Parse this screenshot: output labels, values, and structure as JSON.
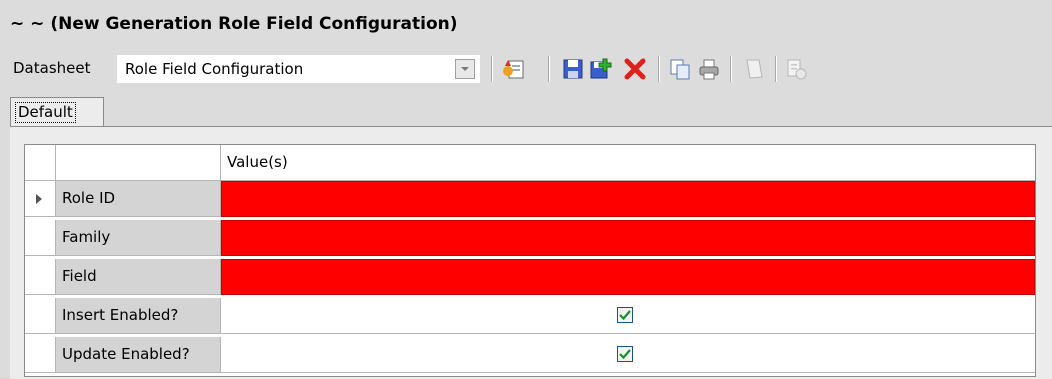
{
  "header": {
    "title": "~ ~ (New Generation Role Field Configuration)"
  },
  "toolbar": {
    "datasheet_label": "Datasheet",
    "datasheet_value": "Role Field Configuration",
    "icons": [
      "new-record-icon",
      "save-icon",
      "add-icon",
      "delete-icon",
      "copy-icon",
      "print-icon",
      "blank-icon",
      "report-icon"
    ]
  },
  "tabs": [
    {
      "label": "Default"
    }
  ],
  "grid": {
    "value_header": "Value(s)",
    "rows": [
      {
        "label": "Role ID",
        "state": "error"
      },
      {
        "label": "Family",
        "state": "error"
      },
      {
        "label": "Field",
        "state": "error"
      },
      {
        "label": "Insert Enabled?",
        "checked": true
      },
      {
        "label": "Update Enabled?",
        "checked": true
      }
    ]
  },
  "colors": {
    "error": "#ff0000",
    "check": "#1d8d2a"
  }
}
